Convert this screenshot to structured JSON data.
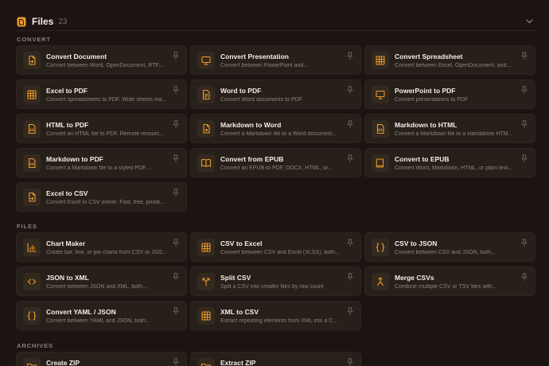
{
  "header": {
    "title": "Files",
    "count": "23",
    "icon": "file-icon",
    "collapse_icon": "chevron-down-icon"
  },
  "accent_color": "#e89a2c",
  "sections": [
    {
      "label": "CONVERT",
      "items": [
        {
          "title": "Convert Document",
          "desc": "Convert between Word, OpenDocument, RTF,...",
          "icon": "file-convert-icon"
        },
        {
          "title": "Convert Presentation",
          "desc": "Convert between PowerPoint and...",
          "icon": "presentation-icon"
        },
        {
          "title": "Convert Spreadsheet",
          "desc": "Convert between Excel, OpenDocument, and...",
          "icon": "spreadsheet-icon"
        },
        {
          "title": "Excel to PDF",
          "desc": "Convert spreadsheets to PDF. Wide sheets ma...",
          "icon": "spreadsheet-icon"
        },
        {
          "title": "Word to PDF",
          "desc": "Convert Word documents to PDF",
          "icon": "document-icon"
        },
        {
          "title": "PowerPoint to PDF",
          "desc": "Convert presentations to PDF",
          "icon": "presentation-icon"
        },
        {
          "title": "HTML to PDF",
          "desc": "Convert an HTML file to PDF. Remote resource...",
          "icon": "code-file-icon"
        },
        {
          "title": "Markdown to Word",
          "desc": "Convert a Markdown file to a Word document...",
          "icon": "file-convert-icon"
        },
        {
          "title": "Markdown to HTML",
          "desc": "Convert a Markdown file to a standalone HTM...",
          "icon": "code-file-icon"
        },
        {
          "title": "Markdown to PDF",
          "desc": "Convert a Markdown file to a styled PDF....",
          "icon": "code-file-icon"
        },
        {
          "title": "Convert from EPUB",
          "desc": "Convert an EPUB to PDF, DOCX, HTML, or...",
          "icon": "book-open-icon"
        },
        {
          "title": "Convert to EPUB",
          "desc": "Convert Word, Markdown, HTML, or plain text...",
          "icon": "book-icon"
        },
        {
          "title": "Excel to CSV",
          "desc": "Convert Excel to CSV online. Fast, free, private,...",
          "icon": "file-convert-icon"
        }
      ]
    },
    {
      "label": "FILES",
      "items": [
        {
          "title": "Chart Maker",
          "desc": "Create bar, line, or pie charts from CSV or JSO...",
          "icon": "bar-chart-icon"
        },
        {
          "title": "CSV to Excel",
          "desc": "Convert between CSV and Excel (XLSX), both...",
          "icon": "spreadsheet-icon"
        },
        {
          "title": "CSV to JSON",
          "desc": "Convert between CSV and JSON, both...",
          "icon": "braces-icon"
        },
        {
          "title": "JSON to XML",
          "desc": "Convert between JSON and XML, both...",
          "icon": "code-icon"
        },
        {
          "title": "Split CSV",
          "desc": "Split a CSV into smaller files by row count",
          "icon": "split-icon"
        },
        {
          "title": "Merge CSVs",
          "desc": "Combine multiple CSV or TSV files with...",
          "icon": "merge-icon"
        },
        {
          "title": "Convert YAML / JSON",
          "desc": "Convert between YAML and JSON, both...",
          "icon": "braces-icon"
        },
        {
          "title": "XML to CSV",
          "desc": "Extract repeating elements from XML into a C...",
          "icon": "spreadsheet-icon"
        }
      ]
    },
    {
      "label": "ARCHIVES",
      "items": [
        {
          "title": "Create ZIP",
          "desc": "",
          "icon": "folder-icon"
        },
        {
          "title": "Extract ZIP",
          "desc": "",
          "icon": "folder-icon"
        }
      ]
    }
  ]
}
